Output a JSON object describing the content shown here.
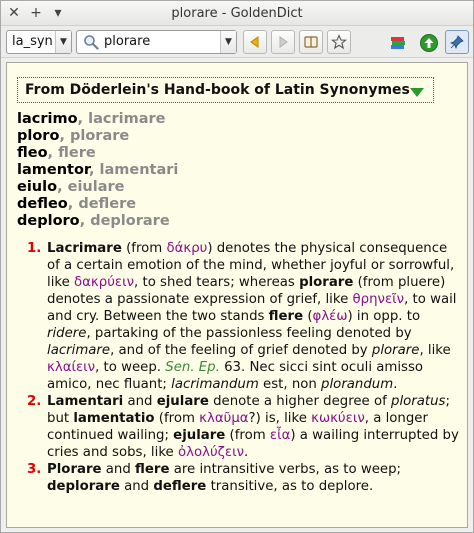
{
  "window": {
    "title": "plorare - GoldenDict"
  },
  "titlebar": {
    "close_glyph": "✕",
    "add_glyph": "+",
    "menu_glyph": "▾"
  },
  "toolbar": {
    "group_value": "la_syn",
    "search_value": "plorare",
    "icons": [
      "back-icon",
      "forward-icon",
      "book-icon",
      "star-icon",
      "dictionaries-icon",
      "up-icon",
      "pin-icon"
    ]
  },
  "article": {
    "dictionary_name": "From Döderlein's Hand-book of Latin Synonymes",
    "headwords": [
      {
        "main": "lacrimo",
        "sep": ", ",
        "alt": "lacrimare"
      },
      {
        "main": "ploro",
        "sep": ", ",
        "alt": "plorare"
      },
      {
        "main": "fleo",
        "sep": ", ",
        "alt": "flere"
      },
      {
        "main": "lamentor",
        "sep": ", ",
        "alt": "lamentari"
      },
      {
        "main": "eiulo",
        "sep": ", ",
        "alt": "eiulare"
      },
      {
        "main": "defleo",
        "sep": ", ",
        "alt": "deflere"
      },
      {
        "main": "deploro",
        "sep": ", ",
        "alt": "deplorare"
      }
    ],
    "definitions": [
      {
        "num": "1.",
        "parts": [
          {
            "t": "Lacrimare",
            "s": "b"
          },
          {
            "t": " (from "
          },
          {
            "t": "δάκρυ",
            "s": "gr"
          },
          {
            "t": ") denotes the physical consequence of a certain emotion of the mind, whether joyful or sorrowful, like "
          },
          {
            "t": "δακρύειν",
            "s": "gr"
          },
          {
            "t": ", to shed tears; whereas "
          },
          {
            "t": "plorare",
            "s": "b"
          },
          {
            "t": " (from pluere) denotes a passionate expression of grief, like "
          },
          {
            "t": "θρηνεῖν",
            "s": "gr"
          },
          {
            "t": ", to wail and cry. Between the two stands "
          },
          {
            "t": "flere",
            "s": "b"
          },
          {
            "t": " ("
          },
          {
            "t": "φλέω",
            "s": "gr"
          },
          {
            "t": ") in opp. to "
          },
          {
            "t": "ridere",
            "s": "i"
          },
          {
            "t": ", partaking of the passionless feeling denoted by "
          },
          {
            "t": "lacrimare",
            "s": "i"
          },
          {
            "t": ", and of the feeling of grief denoted by "
          },
          {
            "t": "plorare",
            "s": "i"
          },
          {
            "t": ", like "
          },
          {
            "t": "κλαίειν",
            "s": "gr"
          },
          {
            "t": ", to weep. "
          },
          {
            "t": "Sen. Ep.",
            "s": "ref"
          },
          {
            "t": " 63. Nec sicci sint oculi amisso amico, nec fluant; "
          },
          {
            "t": "lacrimandum",
            "s": "i"
          },
          {
            "t": " est, non "
          },
          {
            "t": "plorandum",
            "s": "i"
          },
          {
            "t": "."
          }
        ]
      },
      {
        "num": "2.",
        "parts": [
          {
            "t": "Lamentari",
            "s": "b"
          },
          {
            "t": " and "
          },
          {
            "t": "ejulare",
            "s": "b"
          },
          {
            "t": " denote a higher degree of "
          },
          {
            "t": "ploratus",
            "s": "i"
          },
          {
            "t": "; but "
          },
          {
            "t": "lamentatio",
            "s": "b"
          },
          {
            "t": " (from "
          },
          {
            "t": "κλαῦμα",
            "s": "gr"
          },
          {
            "t": "?) is, like "
          },
          {
            "t": "κωκύειν",
            "s": "gr"
          },
          {
            "t": ", a longer continued wailing; "
          },
          {
            "t": "ejulare",
            "s": "b"
          },
          {
            "t": " (from "
          },
          {
            "t": "εἶα",
            "s": "gr"
          },
          {
            "t": ") a wailing interrupted by cries and sobs, like "
          },
          {
            "t": "ὀλολύζειν",
            "s": "gr"
          },
          {
            "t": "."
          }
        ]
      },
      {
        "num": "3.",
        "parts": [
          {
            "t": "Plorare",
            "s": "b"
          },
          {
            "t": " and "
          },
          {
            "t": "flere",
            "s": "b"
          },
          {
            "t": " are intransitive verbs, as to weep; "
          },
          {
            "t": "deplorare",
            "s": "b"
          },
          {
            "t": " and "
          },
          {
            "t": "deflere",
            "s": "b"
          },
          {
            "t": " transitive, as to deplore."
          }
        ]
      }
    ]
  },
  "colors": {
    "article_bg": "#fefde8",
    "number": "#e00000",
    "greek": "#8a0f8a",
    "reference": "#3a8a3a",
    "alt_word": "#8a8a8a"
  }
}
